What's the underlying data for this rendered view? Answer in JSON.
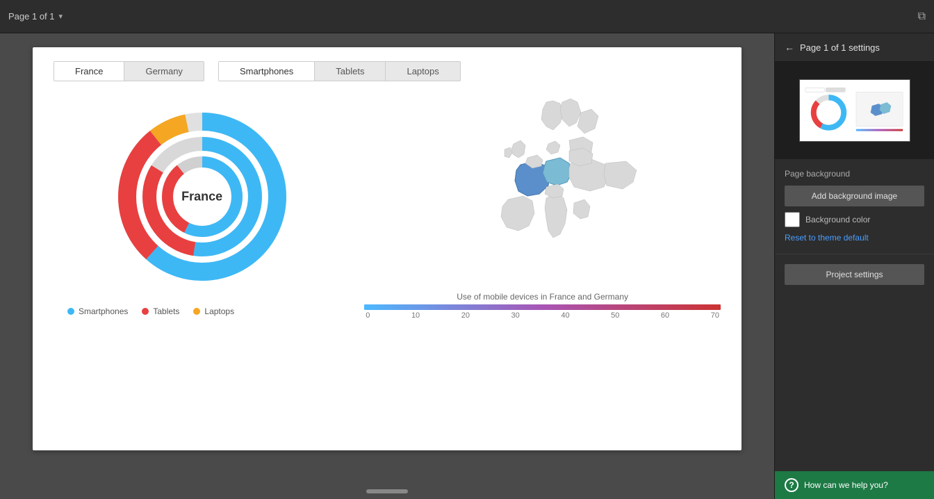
{
  "topbar": {
    "title": "Page 1 of 1",
    "chevron": "▾",
    "copy_icon": "⧉"
  },
  "tabs_left": {
    "items": [
      {
        "label": "France",
        "active": true
      },
      {
        "label": "Germany",
        "active": false
      }
    ]
  },
  "tabs_right": {
    "items": [
      {
        "label": "Smartphones",
        "active": true
      },
      {
        "label": "Tablets",
        "active": false
      },
      {
        "label": "Laptops",
        "active": false
      }
    ]
  },
  "donut": {
    "center_label": "France"
  },
  "legend": {
    "items": [
      {
        "label": "Smartphones",
        "color": "#3db8f5"
      },
      {
        "label": "Tablets",
        "color": "#e84040"
      },
      {
        "label": "Laptops",
        "color": "#f5a623"
      }
    ]
  },
  "color_bar": {
    "title": "Use of mobile devices in France and Germany",
    "labels": [
      "0",
      "10",
      "20",
      "30",
      "40",
      "50",
      "60",
      "70"
    ]
  },
  "right_panel": {
    "title": "Page 1 of 1 settings",
    "back_arrow": "←",
    "page_background_label": "Page background",
    "add_background_btn": "Add background image",
    "background_color_label": "Background color",
    "reset_link": "Reset to theme default",
    "project_settings_btn": "Project settings"
  },
  "help_bar": {
    "text": "How can we help you?",
    "icon": "?"
  }
}
